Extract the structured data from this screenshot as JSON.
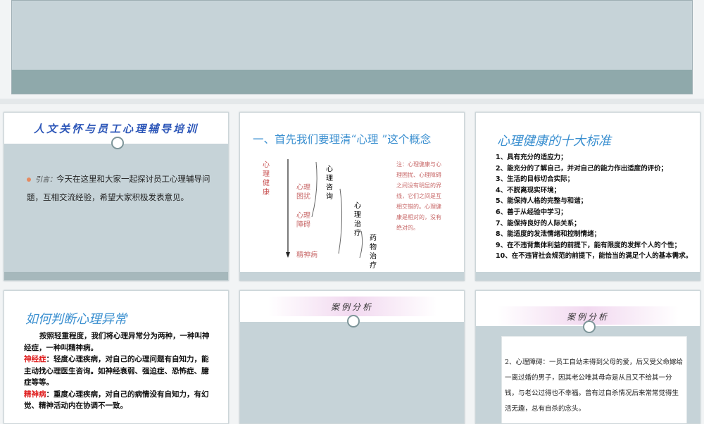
{
  "slides": {
    "s1": {
      "title": "人文关怀与员工心理辅导培训",
      "lead": "引言：",
      "text": "今天在这里和大家一起探讨员工心理辅导问题，互相交流经验，希望大家积极发表意见。"
    },
    "s2": {
      "title": "一、首先我们要理清“心理 ”这个概念",
      "left_label": "心理健康",
      "mid_labels": [
        "心理困扰",
        "心理障碍",
        "精神病"
      ],
      "col1": "心理咨询",
      "col2": "心理治疗",
      "col3": "药物治疗",
      "note": "注：心理健康与心理困扰、心理障碍之间没有明显的界线，它们之间是互相交错的。心理健康是相对的，没有绝对的。"
    },
    "s3": {
      "title": "心理健康的十大标准",
      "items": [
        "1、具有充分的适应力；",
        "2、能充分的了解自己，并对自己的能力作出适度的评价；",
        "3、生活的目标切合实际；",
        "4、不脱离现实环境；",
        "5、能保持人格的完整与和谐；",
        "6、善于从经验中学习；",
        "7、能保持良好的人际关系；",
        "8、能适度的发泄情绪和控制情绪；",
        "9、在不违背集体利益的前提下，能有限度的发挥个人的个性；",
        "10、在不违背社会规范的前提下，能恰当的满足个人的基本需求。"
      ]
    },
    "s4": {
      "title": "如何判断心理异常",
      "intro": "按照轻重程度，我们将心理异常分为两种，一种叫神经症，一种叫精神病。",
      "term1": "神经症",
      "desc1": "：轻度心理疾病，对自己的心理问题有自知力，能主动找心理医生咨询。如神经衰弱、强迫症、恐怖症、臆症等等。",
      "term2": "精神病",
      "desc2": "：重度心理疾病，对自己的病情没有自知力，有幻觉、精神活动内在协调不一致。"
    },
    "s5": {
      "title": "案例分析"
    },
    "s6": {
      "title": "案例分析",
      "text": "2、心理障碍：一员工自幼未得到父母的爱，后又受父命嫁给一离过婚的男子，因其老公唯其母命是从且又不给其一分钱，与老公过得也不幸福。曾有过自杀情况后来常常觉得生活无趣，总有自杀的念头。"
    }
  },
  "colors": {
    "grey_band": "#c6d3d8",
    "teal_band": "#a6b8bc",
    "title_blue": "#3a8fd0",
    "accent_red": "#e02020"
  }
}
